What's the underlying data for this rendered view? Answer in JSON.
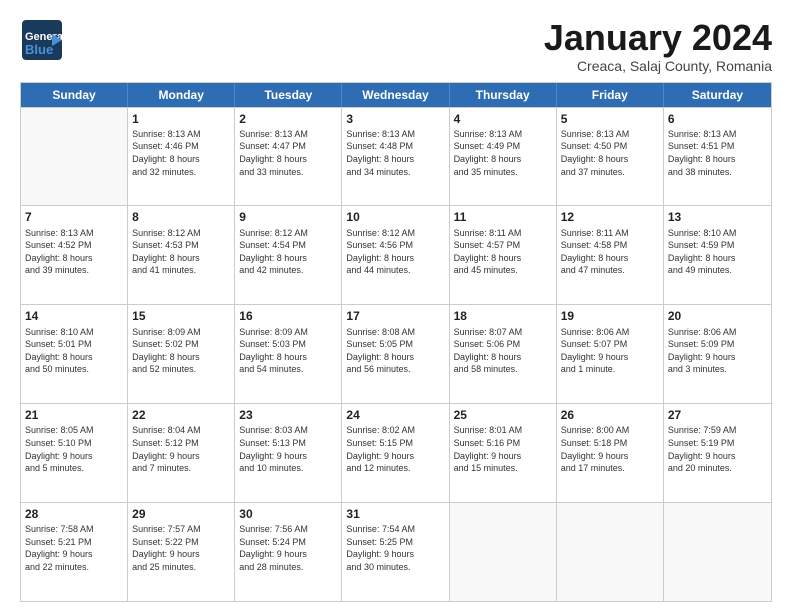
{
  "logo": {
    "line1": "General",
    "line2": "Blue"
  },
  "title": "January 2024",
  "subtitle": "Creaca, Salaj County, Romania",
  "weekdays": [
    "Sunday",
    "Monday",
    "Tuesday",
    "Wednesday",
    "Thursday",
    "Friday",
    "Saturday"
  ],
  "weeks": [
    [
      {
        "day": "",
        "info": ""
      },
      {
        "day": "1",
        "info": "Sunrise: 8:13 AM\nSunset: 4:46 PM\nDaylight: 8 hours\nand 32 minutes."
      },
      {
        "day": "2",
        "info": "Sunrise: 8:13 AM\nSunset: 4:47 PM\nDaylight: 8 hours\nand 33 minutes."
      },
      {
        "day": "3",
        "info": "Sunrise: 8:13 AM\nSunset: 4:48 PM\nDaylight: 8 hours\nand 34 minutes."
      },
      {
        "day": "4",
        "info": "Sunrise: 8:13 AM\nSunset: 4:49 PM\nDaylight: 8 hours\nand 35 minutes."
      },
      {
        "day": "5",
        "info": "Sunrise: 8:13 AM\nSunset: 4:50 PM\nDaylight: 8 hours\nand 37 minutes."
      },
      {
        "day": "6",
        "info": "Sunrise: 8:13 AM\nSunset: 4:51 PM\nDaylight: 8 hours\nand 38 minutes."
      }
    ],
    [
      {
        "day": "7",
        "info": "Sunrise: 8:13 AM\nSunset: 4:52 PM\nDaylight: 8 hours\nand 39 minutes."
      },
      {
        "day": "8",
        "info": "Sunrise: 8:12 AM\nSunset: 4:53 PM\nDaylight: 8 hours\nand 41 minutes."
      },
      {
        "day": "9",
        "info": "Sunrise: 8:12 AM\nSunset: 4:54 PM\nDaylight: 8 hours\nand 42 minutes."
      },
      {
        "day": "10",
        "info": "Sunrise: 8:12 AM\nSunset: 4:56 PM\nDaylight: 8 hours\nand 44 minutes."
      },
      {
        "day": "11",
        "info": "Sunrise: 8:11 AM\nSunset: 4:57 PM\nDaylight: 8 hours\nand 45 minutes."
      },
      {
        "day": "12",
        "info": "Sunrise: 8:11 AM\nSunset: 4:58 PM\nDaylight: 8 hours\nand 47 minutes."
      },
      {
        "day": "13",
        "info": "Sunrise: 8:10 AM\nSunset: 4:59 PM\nDaylight: 8 hours\nand 49 minutes."
      }
    ],
    [
      {
        "day": "14",
        "info": "Sunrise: 8:10 AM\nSunset: 5:01 PM\nDaylight: 8 hours\nand 50 minutes."
      },
      {
        "day": "15",
        "info": "Sunrise: 8:09 AM\nSunset: 5:02 PM\nDaylight: 8 hours\nand 52 minutes."
      },
      {
        "day": "16",
        "info": "Sunrise: 8:09 AM\nSunset: 5:03 PM\nDaylight: 8 hours\nand 54 minutes."
      },
      {
        "day": "17",
        "info": "Sunrise: 8:08 AM\nSunset: 5:05 PM\nDaylight: 8 hours\nand 56 minutes."
      },
      {
        "day": "18",
        "info": "Sunrise: 8:07 AM\nSunset: 5:06 PM\nDaylight: 8 hours\nand 58 minutes."
      },
      {
        "day": "19",
        "info": "Sunrise: 8:06 AM\nSunset: 5:07 PM\nDaylight: 9 hours\nand 1 minute."
      },
      {
        "day": "20",
        "info": "Sunrise: 8:06 AM\nSunset: 5:09 PM\nDaylight: 9 hours\nand 3 minutes."
      }
    ],
    [
      {
        "day": "21",
        "info": "Sunrise: 8:05 AM\nSunset: 5:10 PM\nDaylight: 9 hours\nand 5 minutes."
      },
      {
        "day": "22",
        "info": "Sunrise: 8:04 AM\nSunset: 5:12 PM\nDaylight: 9 hours\nand 7 minutes."
      },
      {
        "day": "23",
        "info": "Sunrise: 8:03 AM\nSunset: 5:13 PM\nDaylight: 9 hours\nand 10 minutes."
      },
      {
        "day": "24",
        "info": "Sunrise: 8:02 AM\nSunset: 5:15 PM\nDaylight: 9 hours\nand 12 minutes."
      },
      {
        "day": "25",
        "info": "Sunrise: 8:01 AM\nSunset: 5:16 PM\nDaylight: 9 hours\nand 15 minutes."
      },
      {
        "day": "26",
        "info": "Sunrise: 8:00 AM\nSunset: 5:18 PM\nDaylight: 9 hours\nand 17 minutes."
      },
      {
        "day": "27",
        "info": "Sunrise: 7:59 AM\nSunset: 5:19 PM\nDaylight: 9 hours\nand 20 minutes."
      }
    ],
    [
      {
        "day": "28",
        "info": "Sunrise: 7:58 AM\nSunset: 5:21 PM\nDaylight: 9 hours\nand 22 minutes."
      },
      {
        "day": "29",
        "info": "Sunrise: 7:57 AM\nSunset: 5:22 PM\nDaylight: 9 hours\nand 25 minutes."
      },
      {
        "day": "30",
        "info": "Sunrise: 7:56 AM\nSunset: 5:24 PM\nDaylight: 9 hours\nand 28 minutes."
      },
      {
        "day": "31",
        "info": "Sunrise: 7:54 AM\nSunset: 5:25 PM\nDaylight: 9 hours\nand 30 minutes."
      },
      {
        "day": "",
        "info": ""
      },
      {
        "day": "",
        "info": ""
      },
      {
        "day": "",
        "info": ""
      }
    ]
  ]
}
